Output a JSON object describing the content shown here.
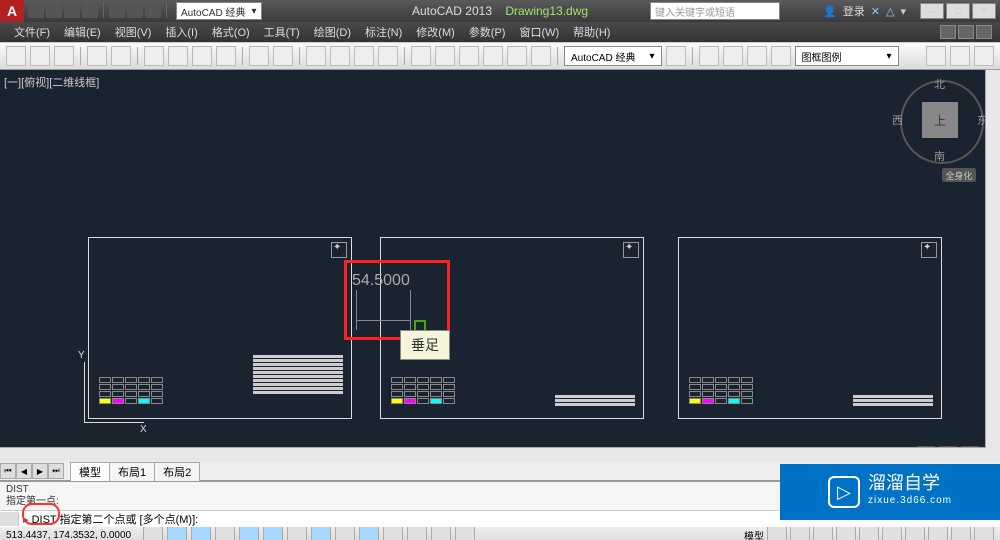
{
  "title": {
    "app": "AutoCAD 2013",
    "file": "Drawing13.dwg"
  },
  "qat_workspace": "AutoCAD 经典",
  "search_placeholder": "键入关键字或短语",
  "login": "登录",
  "menus": [
    "文件(F)",
    "编辑(E)",
    "视图(V)",
    "插入(I)",
    "格式(O)",
    "工具(T)",
    "绘图(D)",
    "标注(N)",
    "修改(M)",
    "参数(P)",
    "窗口(W)",
    "帮助(H)"
  ],
  "tool_dropdown_workspace": "AutoCAD 经典",
  "tool_dropdown_legend": "图框图例",
  "viewport_label": "[一][俯视][二维线框]",
  "viewcube": {
    "face": "上",
    "n": "北",
    "s": "南",
    "e": "东",
    "w": "西"
  },
  "full_warn": "全身化",
  "dimension_value": "54.5000",
  "snap_tooltip": "垂足",
  "tabs": [
    "模型",
    "布局1",
    "布局2"
  ],
  "cmd_history1": "DIST",
  "cmd_history2": "指定第一点:",
  "cmd_prompt": "DIST 指定第二个点或 [多个点(M)]:",
  "status_coords": "513.4437, 174.3532, 0.0000",
  "status_model_label": "模型",
  "watermark": {
    "main": "溜溜自学",
    "sub": "zixue.3d66.com"
  }
}
